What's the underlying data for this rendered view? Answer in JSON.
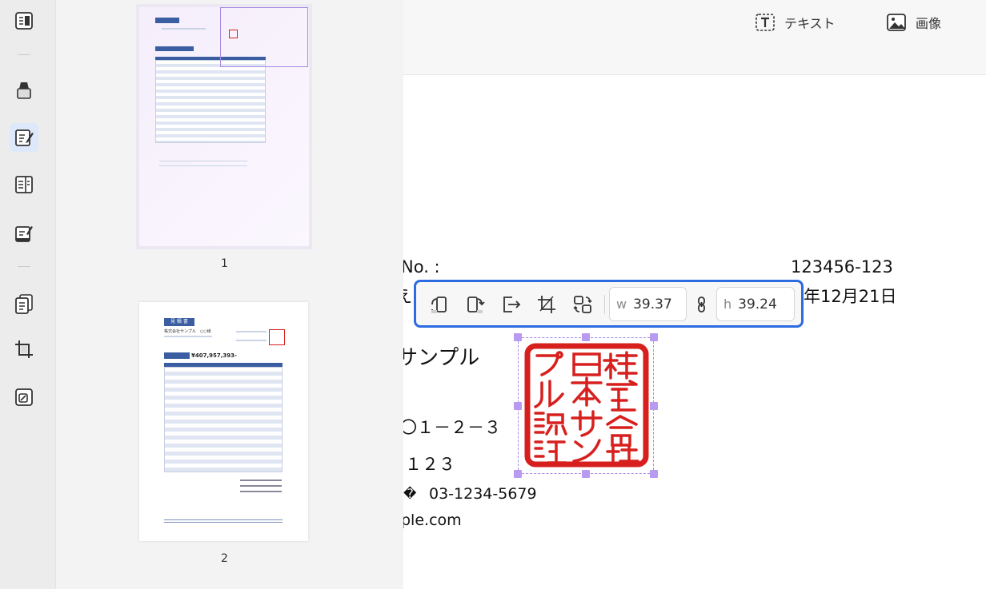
{
  "toolbar": {
    "text_label": "テキスト",
    "image_label": "画像"
  },
  "thumbnails": {
    "pages": [
      {
        "label": "1"
      },
      {
        "label": "2"
      }
    ]
  },
  "thumb2": {
    "title": "見 積 書",
    "company": "株式会社サンプル　○○様",
    "total": "¥407,957,393-"
  },
  "document": {
    "no_label": "No. :",
    "no_value": "123456-123",
    "date": "年12月21日",
    "company": "サンプル",
    "address": "〇１－２－３",
    "zip": "１２３",
    "phone": "03-1234-5679",
    "email": "ple.com"
  },
  "stamp": {
    "text": "株式会社日本サンプル認証"
  },
  "float_toolbar": {
    "w_label": "w",
    "w_value": "39.37",
    "h_label": "h",
    "h_value": "39.24"
  },
  "colors": {
    "accent": "#2d6be0",
    "stamp_red": "#d7201e",
    "selection": "#b89af0"
  }
}
